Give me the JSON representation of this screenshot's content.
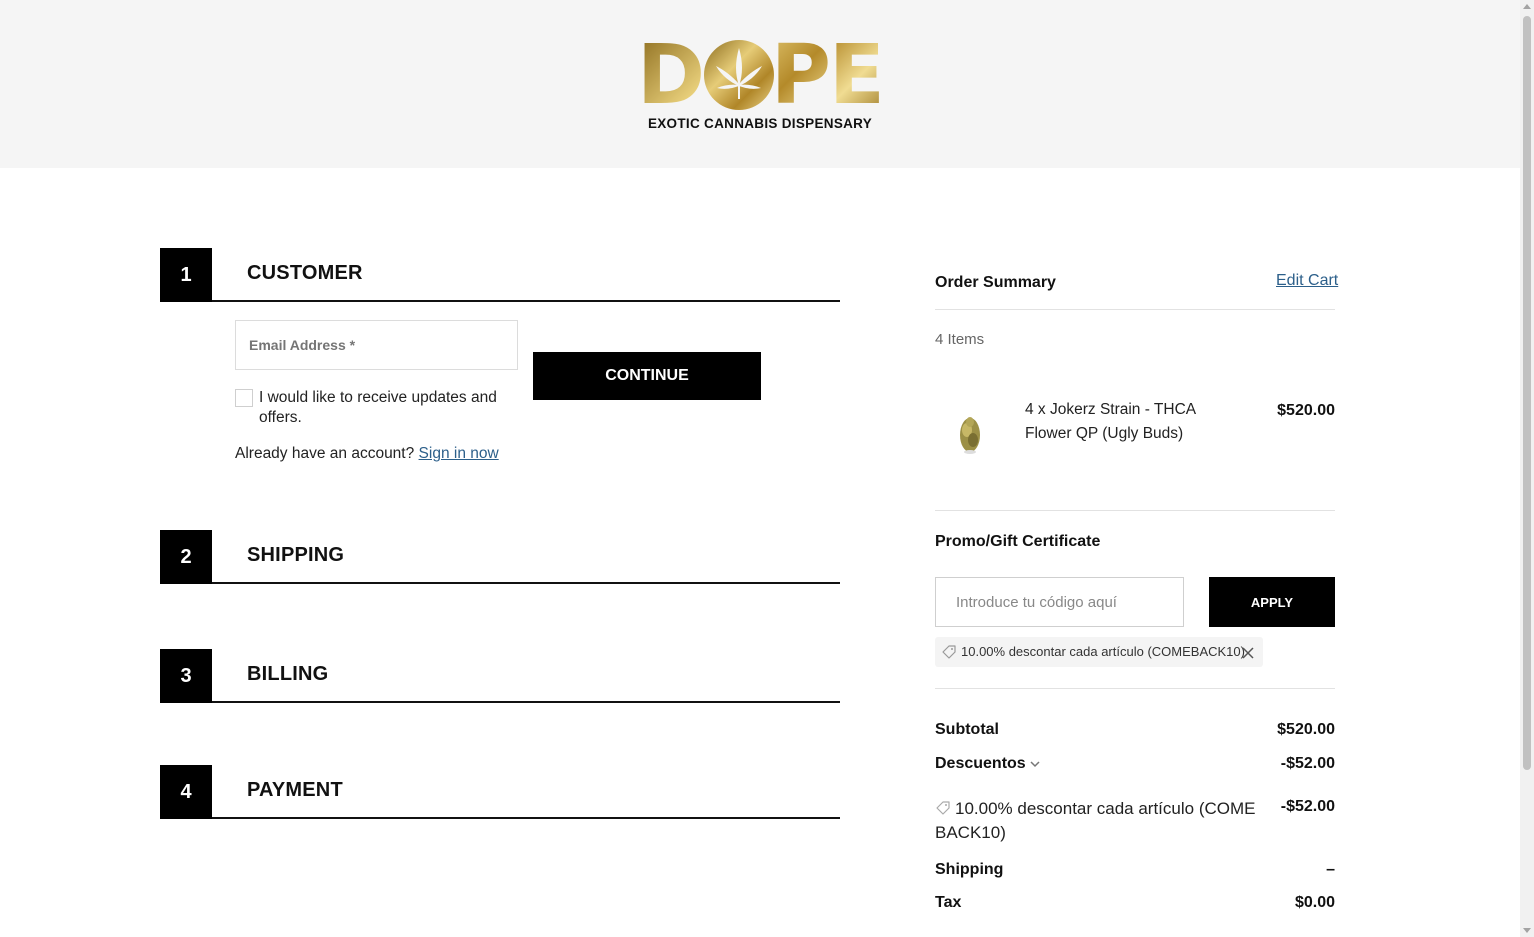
{
  "brand": {
    "logo_word": "DOPE",
    "logo_sub": "EXOTIC CANNABIS DISPENSARY",
    "gold": "#c9a444"
  },
  "steps": [
    {
      "num": "1",
      "title": "CUSTOMER"
    },
    {
      "num": "2",
      "title": "SHIPPING"
    },
    {
      "num": "3",
      "title": "BILLING"
    },
    {
      "num": "4",
      "title": "PAYMENT"
    }
  ],
  "customer": {
    "email_label": "Email Address *",
    "continue_label": "CONTINUE",
    "updates_label": "I would like to receive updates and offers.",
    "account_prompt": "Already have an account?",
    "sign_in_label": "Sign in now"
  },
  "summary": {
    "title": "Order Summary",
    "edit_cart_label": "Edit Cart",
    "items_count": "4 Items",
    "product": {
      "name": "4 x Jokerz Strain - THCA Flower QP (Ugly Buds)",
      "price": "$520.00"
    },
    "promo": {
      "title": "Promo/Gift Certificate",
      "placeholder": "Introduce tu código aquí",
      "apply_label": "APPLY",
      "applied_coupon": "10.00% descontar cada artículo (COMEBACK10)"
    },
    "totals": {
      "subtotal_label": "Subtotal",
      "subtotal_value": "$520.00",
      "discounts_label": "Descuentos",
      "discounts_value": "-$52.00",
      "discount_detail_label": "10.00% descontar cada artículo (COMEBACK10)",
      "discount_detail_value": "-$52.00",
      "shipping_label": "Shipping",
      "shipping_value": "–",
      "tax_label": "Tax",
      "tax_value": "$0.00"
    }
  }
}
